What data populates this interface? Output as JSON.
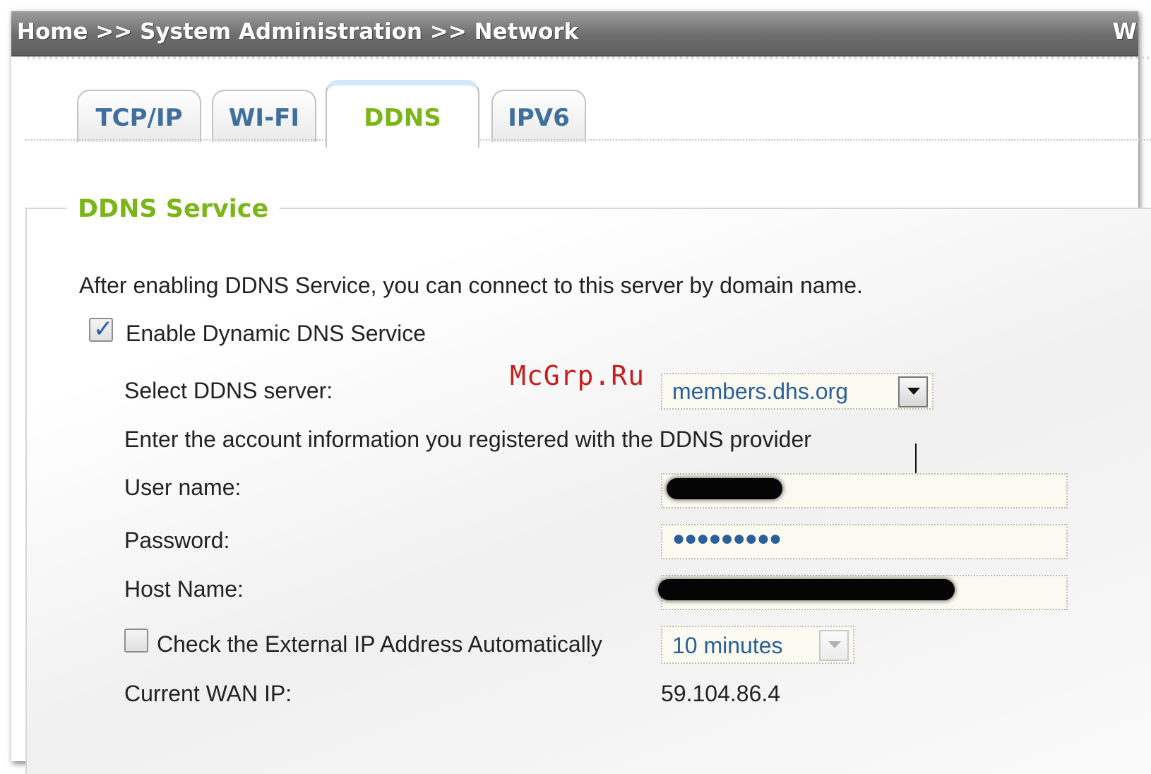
{
  "header": {
    "breadcrumb": "Home >> System Administration >> Network",
    "right_fragment": "W"
  },
  "tabs": [
    {
      "label": "TCP/IP",
      "active": false
    },
    {
      "label": "WI-FI",
      "active": false
    },
    {
      "label": "DDNS",
      "active": true
    },
    {
      "label": "IPV6",
      "active": false
    }
  ],
  "section": {
    "title": "DDNS Service",
    "description": "After enabling DDNS Service, you can connect to this server by domain name.",
    "enable_label": "Enable Dynamic DNS Service",
    "enable_checked": true,
    "server_label": "Select DDNS server:",
    "server_value": "members.dhs.org",
    "account_note": "Enter the account information you registered with the DDNS provider",
    "username_label": "User name:",
    "password_label": "Password:",
    "password_value": "●●●●●●●●●",
    "hostname_label": "Host Name:",
    "auto_check_label": "Check the External IP Address Automatically",
    "auto_check_checked": false,
    "interval_value": "10 minutes",
    "wan_label": "Current WAN IP:",
    "wan_value": "59.104.86.4"
  },
  "watermark": "McGrp.Ru",
  "colors": {
    "accent_green": "#7cb518",
    "tab_blue": "#3f6f9c",
    "field_text": "#2a5f9a",
    "watermark_red": "#c81e1e"
  }
}
